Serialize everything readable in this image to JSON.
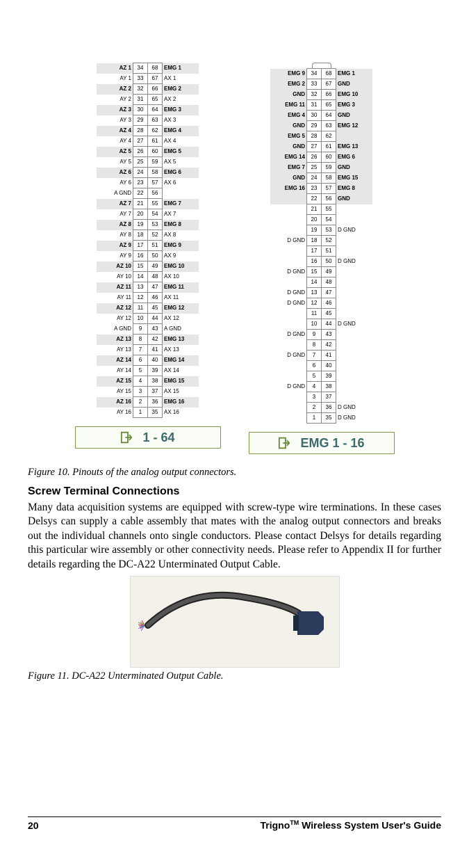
{
  "conn_left": {
    "rows": [
      {
        "l": "AZ 1",
        "a": "34",
        "b": "68",
        "r": "EMG 1",
        "alt": true
      },
      {
        "l": "AY 1",
        "a": "33",
        "b": "67",
        "r": "AX 1",
        "alt": false
      },
      {
        "l": "AZ 2",
        "a": "32",
        "b": "66",
        "r": "EMG 2",
        "alt": true
      },
      {
        "l": "AY 2",
        "a": "31",
        "b": "65",
        "r": "AX 2",
        "alt": false
      },
      {
        "l": "AZ 3",
        "a": "30",
        "b": "64",
        "r": "EMG 3",
        "alt": true
      },
      {
        "l": "AY 3",
        "a": "29",
        "b": "63",
        "r": "AX 3",
        "alt": false
      },
      {
        "l": "AZ 4",
        "a": "28",
        "b": "62",
        "r": "EMG 4",
        "alt": true
      },
      {
        "l": "AY 4",
        "a": "27",
        "b": "61",
        "r": "AX 4",
        "alt": false
      },
      {
        "l": "AZ 5",
        "a": "26",
        "b": "60",
        "r": "EMG 5",
        "alt": true
      },
      {
        "l": "AY 5",
        "a": "25",
        "b": "59",
        "r": "AX 5",
        "alt": false
      },
      {
        "l": "AZ 6",
        "a": "24",
        "b": "58",
        "r": "EMG 6",
        "alt": true
      },
      {
        "l": "AY 6",
        "a": "23",
        "b": "57",
        "r": "AX 6",
        "alt": false
      },
      {
        "l": "A GND",
        "a": "22",
        "b": "56",
        "r": "",
        "alt": false
      },
      {
        "l": "AZ 7",
        "a": "21",
        "b": "55",
        "r": "EMG 7",
        "alt": true
      },
      {
        "l": "AY 7",
        "a": "20",
        "b": "54",
        "r": "AX 7",
        "alt": false
      },
      {
        "l": "AZ 8",
        "a": "19",
        "b": "53",
        "r": "EMG 8",
        "alt": true
      },
      {
        "l": "AY 8",
        "a": "18",
        "b": "52",
        "r": "AX 8",
        "alt": false
      },
      {
        "l": "AZ 9",
        "a": "17",
        "b": "51",
        "r": "EMG 9",
        "alt": true
      },
      {
        "l": "AY 9",
        "a": "16",
        "b": "50",
        "r": "AX 9",
        "alt": false
      },
      {
        "l": "AZ 10",
        "a": "15",
        "b": "49",
        "r": "EMG 10",
        "alt": true
      },
      {
        "l": "AY 10",
        "a": "14",
        "b": "48",
        "r": "AX 10",
        "alt": false
      },
      {
        "l": "AZ 11",
        "a": "13",
        "b": "47",
        "r": "EMG 11",
        "alt": true
      },
      {
        "l": "AY 11",
        "a": "12",
        "b": "46",
        "r": "AX 11",
        "alt": false
      },
      {
        "l": "AZ 12",
        "a": "11",
        "b": "45",
        "r": "EMG 12",
        "alt": true
      },
      {
        "l": "AY 12",
        "a": "10",
        "b": "44",
        "r": "AX 12",
        "alt": false
      },
      {
        "l": "A GND",
        "a": "9",
        "b": "43",
        "r": "A GND",
        "alt": false
      },
      {
        "l": "AZ 13",
        "a": "8",
        "b": "42",
        "r": "EMG 13",
        "alt": true
      },
      {
        "l": "AY 13",
        "a": "7",
        "b": "41",
        "r": "AX 13",
        "alt": false
      },
      {
        "l": "AZ 14",
        "a": "6",
        "b": "40",
        "r": "EMG 14",
        "alt": true
      },
      {
        "l": "AY 14",
        "a": "5",
        "b": "39",
        "r": "AX 14",
        "alt": false
      },
      {
        "l": "AZ 15",
        "a": "4",
        "b": "38",
        "r": "EMG 15",
        "alt": true
      },
      {
        "l": "AY 15",
        "a": "3",
        "b": "37",
        "r": "AX 15",
        "alt": false
      },
      {
        "l": "AZ 16",
        "a": "2",
        "b": "36",
        "r": "EMG 16",
        "alt": true
      },
      {
        "l": "AY 16",
        "a": "1",
        "b": "35",
        "r": "AX 16",
        "alt": false
      }
    ],
    "badge": "1 - 64"
  },
  "conn_right": {
    "rows": [
      {
        "l": "EMG 9",
        "a": "34",
        "b": "68",
        "r": "EMG 1",
        "alt": true
      },
      {
        "l": "EMG 2",
        "a": "33",
        "b": "67",
        "r": "GND",
        "alt": true
      },
      {
        "l": "GND",
        "a": "32",
        "b": "66",
        "r": "EMG 10",
        "alt": true
      },
      {
        "l": "EMG 11",
        "a": "31",
        "b": "65",
        "r": "EMG 3",
        "alt": true
      },
      {
        "l": "EMG 4",
        "a": "30",
        "b": "64",
        "r": "GND",
        "alt": true
      },
      {
        "l": "GND",
        "a": "29",
        "b": "63",
        "r": "EMG 12",
        "alt": true
      },
      {
        "l": "EMG 5",
        "a": "28",
        "b": "62",
        "r": "",
        "alt": true
      },
      {
        "l": "GND",
        "a": "27",
        "b": "61",
        "r": "EMG 13",
        "alt": true
      },
      {
        "l": "EMG 14",
        "a": "26",
        "b": "60",
        "r": "EMG 6",
        "alt": true
      },
      {
        "l": "EMG 7",
        "a": "25",
        "b": "59",
        "r": "GND",
        "alt": true
      },
      {
        "l": "GND",
        "a": "24",
        "b": "58",
        "r": "EMG 15",
        "alt": true
      },
      {
        "l": "EMG 16",
        "a": "23",
        "b": "57",
        "r": "EMG 8",
        "alt": true
      },
      {
        "l": "",
        "a": "22",
        "b": "56",
        "r": "GND",
        "alt": true
      },
      {
        "l": "",
        "a": "21",
        "b": "55",
        "r": "",
        "alt": false
      },
      {
        "l": "",
        "a": "20",
        "b": "54",
        "r": "",
        "alt": false
      },
      {
        "l": "",
        "a": "19",
        "b": "53",
        "r": "D GND",
        "alt": false
      },
      {
        "l": "D GND",
        "a": "18",
        "b": "52",
        "r": "",
        "alt": false
      },
      {
        "l": "",
        "a": "17",
        "b": "51",
        "r": "",
        "alt": false
      },
      {
        "l": "",
        "a": "16",
        "b": "50",
        "r": "D GND",
        "alt": false
      },
      {
        "l": "D GND",
        "a": "15",
        "b": "49",
        "r": "",
        "alt": false
      },
      {
        "l": "",
        "a": "14",
        "b": "48",
        "r": "",
        "alt": false
      },
      {
        "l": "D GND",
        "a": "13",
        "b": "47",
        "r": "",
        "alt": false
      },
      {
        "l": "D GND",
        "a": "12",
        "b": "46",
        "r": "",
        "alt": false
      },
      {
        "l": "",
        "a": "11",
        "b": "45",
        "r": "",
        "alt": false
      },
      {
        "l": "",
        "a": "10",
        "b": "44",
        "r": "D GND",
        "alt": false
      },
      {
        "l": "D GND",
        "a": "9",
        "b": "43",
        "r": "",
        "alt": false
      },
      {
        "l": "",
        "a": "8",
        "b": "42",
        "r": "",
        "alt": false
      },
      {
        "l": "D GND",
        "a": "7",
        "b": "41",
        "r": "",
        "alt": false
      },
      {
        "l": "",
        "a": "6",
        "b": "40",
        "r": "",
        "alt": false
      },
      {
        "l": "",
        "a": "5",
        "b": "39",
        "r": "",
        "alt": false
      },
      {
        "l": "D GND",
        "a": "4",
        "b": "38",
        "r": "",
        "alt": false
      },
      {
        "l": "",
        "a": "3",
        "b": "37",
        "r": "",
        "alt": false
      },
      {
        "l": "",
        "a": "2",
        "b": "36",
        "r": "D GND",
        "alt": false
      },
      {
        "l": "",
        "a": "1",
        "b": "35",
        "r": "D GND",
        "alt": false
      }
    ],
    "badge": "EMG 1 - 16"
  },
  "caption10": "Figure 10. Pinouts of the analog output connectors.",
  "heading": "Screw Terminal Connections",
  "body": "Many data acquisition systems are equipped with screw-type wire terminations. In these cases Delsys can supply a cable assembly that mates with the analog output connectors and breaks out the individual channels onto single conductors. Please contact Delsys for details regarding this particular wire assembly or other connectivity needs. Please refer to Appendix II for further details regarding the DC-A22 Unterminated Output Cable.",
  "caption11": "Figure 11. DC-A22 Unterminated Output Cable.",
  "footer": {
    "page": "20",
    "title_pre": "Trigno",
    "title_tm": "TM",
    "title_post": " Wireless System User's Guide"
  }
}
